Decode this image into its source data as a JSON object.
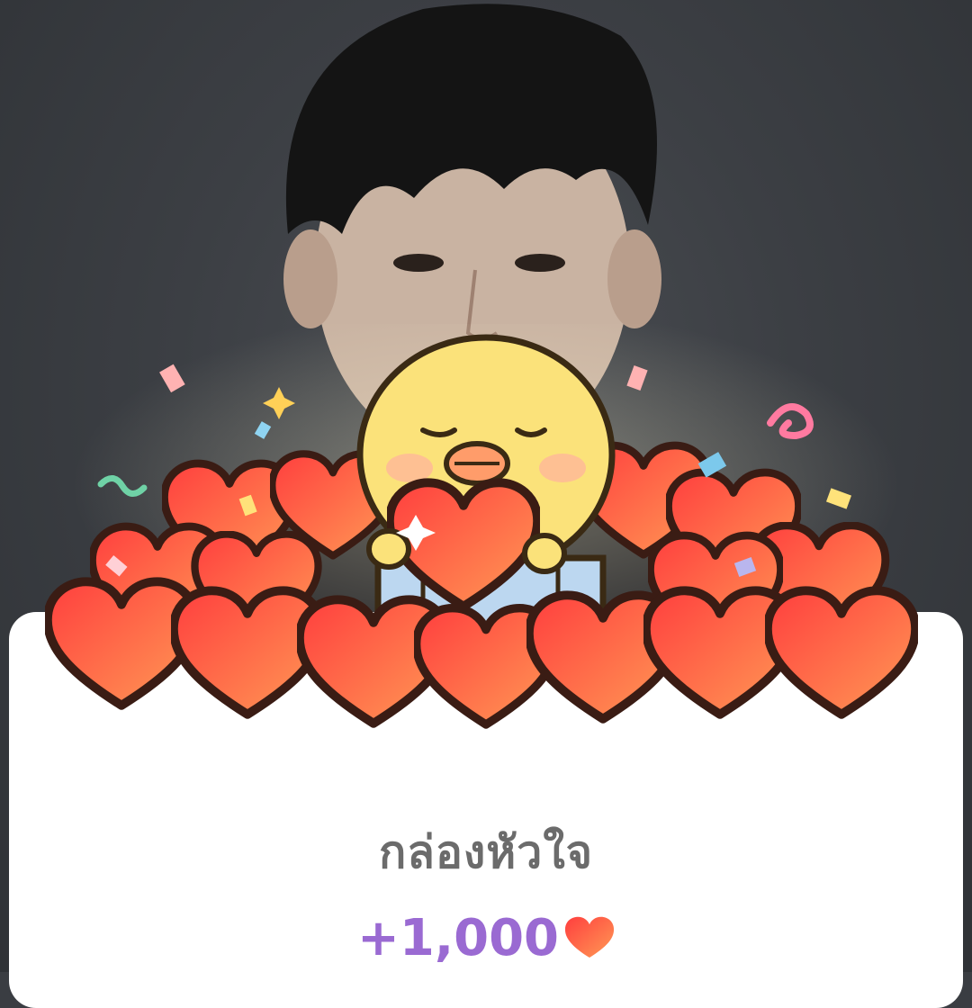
{
  "reward": {
    "title": "กล่องหัวใจ",
    "amount": "+1,000",
    "amount_icon": "heart-icon"
  },
  "colors": {
    "amount": "#9a6ad2",
    "title": "#6b6b6b",
    "heart": "#ff5a3c"
  },
  "sticker": {
    "character": "yellow-chick",
    "icon": "heart-box-sticker"
  }
}
